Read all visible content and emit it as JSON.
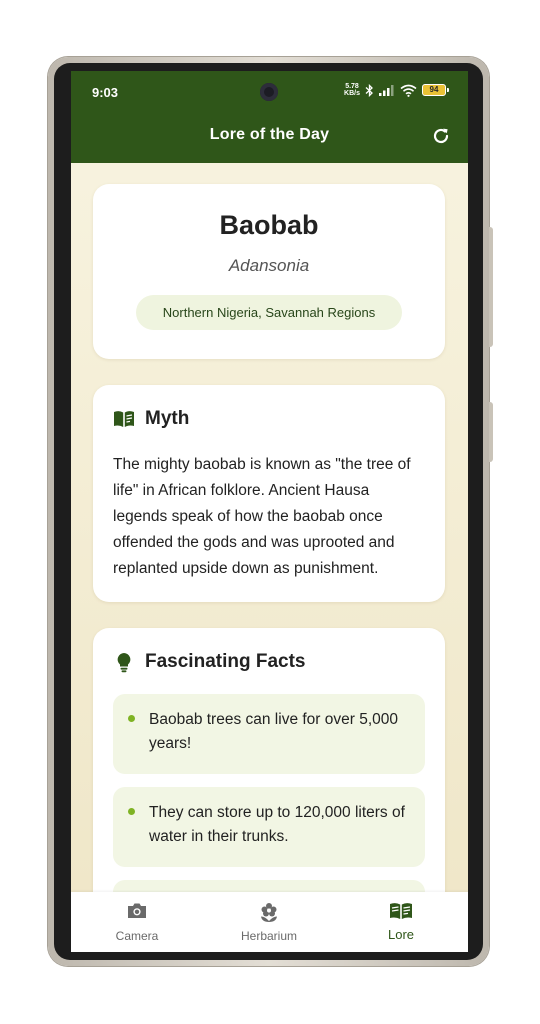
{
  "status_bar": {
    "time": "9:03",
    "net_speed_value": "5.78",
    "net_speed_unit": "KB/s",
    "battery": "94"
  },
  "app_bar": {
    "title": "Lore of the Day"
  },
  "plant": {
    "name": "Baobab",
    "latin_name": "Adansonia",
    "region": "Northern Nigeria, Savannah Regions"
  },
  "myth": {
    "title": "Myth",
    "text": "The mighty baobab is known as \"the tree of life\" in African folklore. Ancient Hausa legends speak of how the baobab once offended the gods and was uprooted and replanted upside down as punishment."
  },
  "facts": {
    "title": "Fascinating Facts",
    "items": [
      "Baobab trees can live for over 5,000 years!",
      "They can store up to 120,000 liters of water in their trunks."
    ]
  },
  "bottom_nav": {
    "items": [
      {
        "label": "Camera",
        "icon": "camera-icon"
      },
      {
        "label": "Herbarium",
        "icon": "flower-icon"
      },
      {
        "label": "Lore",
        "icon": "open-book-icon"
      }
    ],
    "active": "Lore"
  },
  "colors": {
    "primary": "#2f5619",
    "accent": "#7fb324",
    "badge_bg": "#eff4df",
    "fact_bg": "#f2f6e4",
    "background": "#f8f4e1"
  }
}
